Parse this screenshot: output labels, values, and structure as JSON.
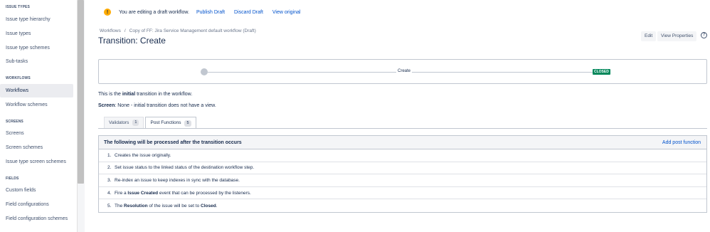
{
  "sidebar": {
    "sections": [
      {
        "heading": "ISSUE TYPES",
        "items": [
          "Issue type hierarchy",
          "Issue types",
          "Issue type schemes",
          "Sub-tasks"
        ]
      },
      {
        "heading": "WORKFLOWS",
        "items": [
          "Workflows",
          "Workflow schemes"
        ]
      },
      {
        "heading": "SCREENS",
        "items": [
          "Screens",
          "Screen schemes",
          "Issue type screen schemes"
        ]
      },
      {
        "heading": "FIELDS",
        "items": [
          "Custom fields",
          "Field configurations",
          "Field configuration schemes"
        ]
      }
    ],
    "active_item": "Workflows"
  },
  "banner": {
    "icon": "warning-icon",
    "text": "You are editing a draft workflow.",
    "publish": "Publish Draft",
    "discard": "Discard Draft",
    "view_original": "View original"
  },
  "breadcrumb": {
    "root": "Workflows",
    "separator": "/",
    "current": "Copy of FF: Jira Service Management default workflow (Draft)"
  },
  "page": {
    "title": "Transition: Create",
    "edit": "Edit",
    "view_properties": "View Properties",
    "help": "?"
  },
  "diagram": {
    "transition_label": "Create",
    "target_status": "CLOSED",
    "status_color": "#00875a"
  },
  "info": {
    "line1_prefix": "This is the ",
    "line1_bold": "initial",
    "line1_suffix": " transition in the workflow.",
    "line2_bold": "Screen",
    "line2_rest": ": None - initial transition does not have a view."
  },
  "tabs": [
    {
      "label": "Validators",
      "count": "1"
    },
    {
      "label": "Post Functions",
      "count": "5"
    }
  ],
  "post_functions": {
    "header": "The following will be processed after the transition occurs",
    "add_label": "Add post function",
    "items": [
      {
        "num": "1.",
        "pre": "Creates the issue originally.",
        "bold": "",
        "mid": "",
        "bold2": "",
        "post": ""
      },
      {
        "num": "2.",
        "pre": "Set issue status to the linked status of the destination workflow step.",
        "bold": "",
        "mid": "",
        "bold2": "",
        "post": ""
      },
      {
        "num": "3.",
        "pre": "Re-index an issue to keep indexes in sync with the database.",
        "bold": "",
        "mid": "",
        "bold2": "",
        "post": ""
      },
      {
        "num": "4.",
        "pre": "Fire a ",
        "bold": "Issue Created",
        "mid": " event that can be processed by the listeners.",
        "bold2": "",
        "post": ""
      },
      {
        "num": "5.",
        "pre": "The ",
        "bold": "Resolution",
        "mid": " of the issue will be set to ",
        "bold2": "Closed",
        "post": "."
      }
    ]
  },
  "colors": {
    "link": "#0052cc",
    "warning": "#ffab00",
    "text": "#172b4d"
  }
}
